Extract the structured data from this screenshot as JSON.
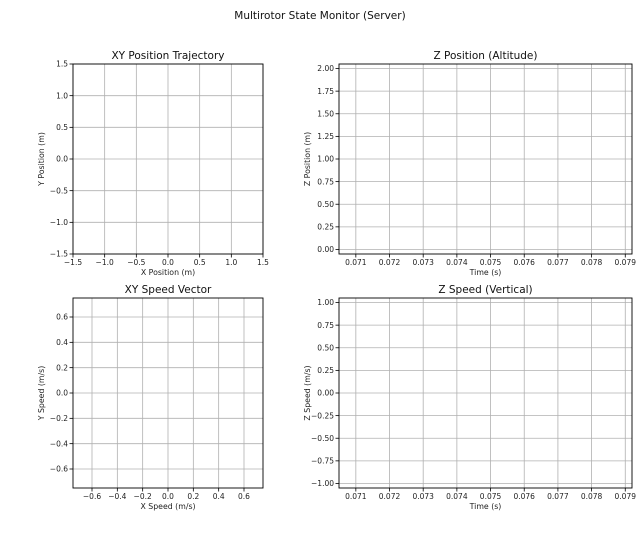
{
  "figure": {
    "suptitle": "Multirotor State Monitor (Server)"
  },
  "chart_data": [
    {
      "type": "line",
      "title": "XY Position Trajectory",
      "xlabel": "X Position (m)",
      "ylabel": "Y Position (m)",
      "xlim": [
        -1.5,
        1.5
      ],
      "ylim": [
        -1.5,
        1.5
      ],
      "xticks": [
        -1.5,
        -1.0,
        -0.5,
        0.0,
        0.5,
        1.0,
        1.5
      ],
      "xtick_labels": [
        "−1.5",
        "−1.0",
        "−0.5",
        "0.0",
        "0.5",
        "1.0",
        "1.5"
      ],
      "yticks": [
        -1.5,
        -1.0,
        -0.5,
        0.0,
        0.5,
        1.0,
        1.5
      ],
      "ytick_labels": [
        "−1.5",
        "−1.0",
        "−0.5",
        "0.0",
        "0.5",
        "1.0",
        "1.5"
      ],
      "grid": true,
      "series": []
    },
    {
      "type": "line",
      "title": "Z Position (Altitude)",
      "xlabel": "Time (s)",
      "ylabel": "Z Position (m)",
      "xlim": [
        0.0705,
        0.0792
      ],
      "ylim": [
        -0.05,
        2.05
      ],
      "xticks": [
        0.071,
        0.072,
        0.073,
        0.074,
        0.075,
        0.076,
        0.077,
        0.078,
        0.079
      ],
      "xtick_labels": [
        "0.071",
        "0.072",
        "0.073",
        "0.074",
        "0.075",
        "0.076",
        "0.077",
        "0.078",
        "0.079"
      ],
      "yticks": [
        0.0,
        0.25,
        0.5,
        0.75,
        1.0,
        1.25,
        1.5,
        1.75,
        2.0
      ],
      "ytick_labels": [
        "0.00",
        "0.25",
        "0.50",
        "0.75",
        "1.00",
        "1.25",
        "1.50",
        "1.75",
        "2.00"
      ],
      "grid": true,
      "series": []
    },
    {
      "type": "line",
      "title": "XY Speed Vector",
      "xlabel": "X Speed (m/s)",
      "ylabel": "Y Speed (m/s)",
      "xlim": [
        -0.75,
        0.75
      ],
      "ylim": [
        -0.75,
        0.75
      ],
      "xticks": [
        -0.6,
        -0.4,
        -0.2,
        0.0,
        0.2,
        0.4,
        0.6
      ],
      "xtick_labels": [
        "−0.6",
        "−0.4",
        "−0.2",
        "0.0",
        "0.2",
        "0.4",
        "0.6"
      ],
      "yticks": [
        -0.6,
        -0.4,
        -0.2,
        0.0,
        0.2,
        0.4,
        0.6
      ],
      "ytick_labels": [
        "−0.6",
        "−0.4",
        "−0.2",
        "0.0",
        "0.2",
        "0.4",
        "0.6"
      ],
      "grid": true,
      "series": []
    },
    {
      "type": "line",
      "title": "Z Speed (Vertical)",
      "xlabel": "Time (s)",
      "ylabel": "Z Speed (m/s)",
      "xlim": [
        0.0705,
        0.0792
      ],
      "ylim": [
        -1.05,
        1.05
      ],
      "xticks": [
        0.071,
        0.072,
        0.073,
        0.074,
        0.075,
        0.076,
        0.077,
        0.078,
        0.079
      ],
      "xtick_labels": [
        "0.071",
        "0.072",
        "0.073",
        "0.074",
        "0.075",
        "0.076",
        "0.077",
        "0.078",
        "0.079"
      ],
      "yticks": [
        -1.0,
        -0.75,
        -0.5,
        -0.25,
        0.0,
        0.25,
        0.5,
        0.75,
        1.0
      ],
      "ytick_labels": [
        "−1.00",
        "−0.75",
        "−0.50",
        "−0.25",
        "0.00",
        "0.25",
        "0.50",
        "0.75",
        "1.00"
      ],
      "grid": true,
      "series": []
    }
  ]
}
